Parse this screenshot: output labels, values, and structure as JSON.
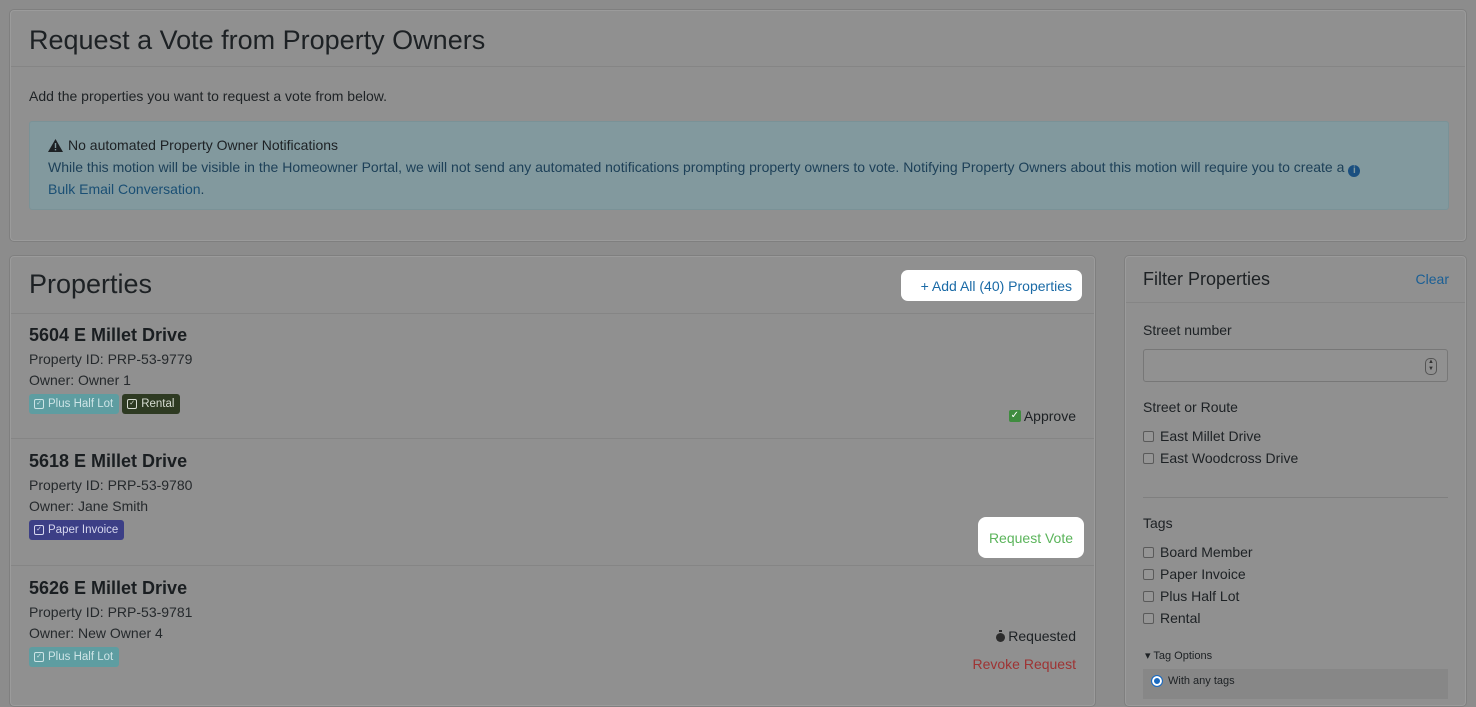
{
  "vote_request": {
    "title": "Request a Vote from Property Owners",
    "intro": "Add the properties you want to request a vote from below.",
    "alert": {
      "icon": "warning-icon",
      "title": "No automated Property Owner Notifications",
      "body": "While this motion will be visible in the Homeowner Portal, we will not send any automated notifications prompting property owners to vote. Notifying Property Owners about this motion will require you to create a",
      "link_text": "Bulk Email Conversation",
      "trailing": "."
    }
  },
  "properties": {
    "title": "Properties",
    "add_all_label": "+ Add All (40) Properties",
    "items": [
      {
        "address": "5604 E Millet Drive",
        "property_id": "Property ID: PRP-53-9779",
        "owner": "Owner: Owner 1",
        "tags": [
          {
            "label": "Plus Half Lot",
            "bg": "#5e9da1",
            "fg": "#cde4e6"
          },
          {
            "label": "Rental",
            "bg": "#2e3a22",
            "fg": "#d7dcd2"
          }
        ],
        "status": "Approve"
      },
      {
        "address": "5618 E Millet Drive",
        "property_id": "Property ID: PRP-53-9780",
        "owner": "Owner: Jane Smith",
        "tags": [
          {
            "label": "Paper Invoice",
            "bg": "#3c3f86",
            "fg": "#d6d7ee"
          }
        ],
        "action_label": "Request Vote"
      },
      {
        "address": "5626 E Millet Drive",
        "property_id": "Property ID: PRP-53-9781",
        "owner": "Owner: New Owner 4",
        "tags": [
          {
            "label": "Plus Half Lot",
            "bg": "#5e9da1",
            "fg": "#cde4e6"
          }
        ],
        "status": "Requested",
        "revoke_label": "Revoke Request"
      }
    ]
  },
  "filter": {
    "title": "Filter Properties",
    "clear_label": "Clear",
    "street_number_label": "Street number",
    "street_number_value": "",
    "street_label": "Street or Route",
    "streets": [
      "East Millet Drive",
      "East Woodcross Drive"
    ],
    "tags_label": "Tags",
    "tags": [
      "Board Member",
      "Paper Invoice",
      "Plus Half Lot",
      "Rental"
    ],
    "tag_options_label": "▾ Tag Options",
    "tag_mode_label": "With any tags"
  },
  "colors": {
    "link": "#1a6aa6",
    "success": "#5bb45b",
    "danger": "#9e3333"
  }
}
